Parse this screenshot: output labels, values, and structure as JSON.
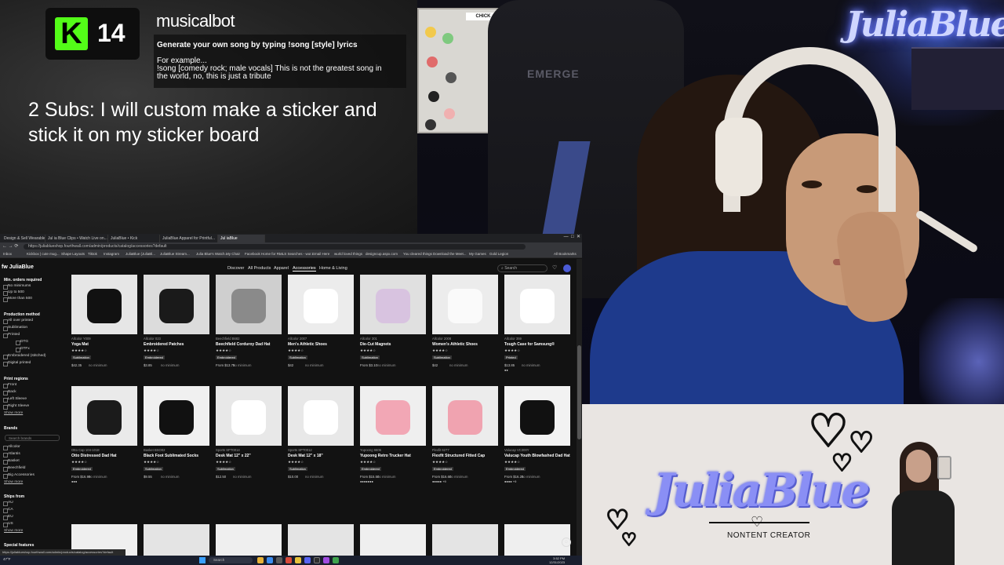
{
  "overlay": {
    "kick_logo": "K",
    "kick_count": "14",
    "bot_title": "musicalbot",
    "bot_line1": "Generate your own song by typing !song [style] lyrics",
    "bot_line2": "For example...",
    "bot_line3": "!song [comedy rock; male vocals] This is not the greatest song in",
    "bot_line4": "the world, no, this is just a tribute",
    "subs_goal": "2 Subs: I will custom make a sticker and stick it on my sticker board",
    "kick_color": "#53fc18"
  },
  "room": {
    "neon_sign": "JuliaBlue",
    "chair_logo": "EMERGE",
    "board_header": "CHICK"
  },
  "brand_panel": {
    "name": "JuliaBlue",
    "tagline": "NONTENT CREATOR",
    "accent": "#8a8ff5"
  },
  "browser": {
    "tabs": [
      "Design & Sell Wearables...",
      "Jul ia Blue Clips • Watch Live on...",
      "JuliaBlue • Kick",
      "JuliaBlue Apparel for Printful...",
      "Jul iaBlue"
    ],
    "url": "https://juliablueshop.fourthwall.com/admin/products/catalog/accessories?default",
    "bookmarks": [
      "Inbox",
      "Kickbox | cute mug...",
      "Shape Layouts",
      "Tiktok",
      "Instagram",
      "JuliaBlue (JuliaBl...",
      "JuliaBlue Stream...",
      "Julia Blue's Watch...",
      "My Chair",
      "Facebook Home for R...",
      "MLS Searches - wor...",
      "Email Here",
      "wurld loved things",
      "designcup.aspx.com",
      "You cleared things",
      "Download the Meet...",
      "My Games",
      "Gold Legion",
      "All Bookmarks"
    ],
    "site_logo": "fw  JuliaBlue",
    "nav": [
      "Discover",
      "All Products",
      "Apparel",
      "Accessories",
      "Home & Living"
    ],
    "active_nav": "Accessories",
    "search_placeholder": "Search",
    "filters": {
      "min_orders_head": "Min. orders required",
      "min_orders": [
        "No minimums",
        "Up to 500",
        "More than 500"
      ],
      "production_head": "Production method",
      "production": [
        "All over printed",
        "Sublimation",
        "Printed",
        "DTG",
        "DTFx",
        "Embroidered (stitched)",
        "Digital printed"
      ],
      "print_regions_head": "Print regions",
      "print_regions": [
        "Front",
        "Back",
        "Left Sleeve",
        "Right Sleeve"
      ],
      "show_more": "Show more",
      "brands_head": "Brands",
      "brand_search": "Search brands",
      "brands": [
        "Allcolor",
        "Atlantis",
        "Basket",
        "Beechfield",
        "Big Accessories"
      ],
      "ships_head": "Ships from",
      "ships": [
        "AU",
        "CA",
        "EU",
        "US"
      ],
      "special_head": "Special features"
    },
    "products_row1": [
      {
        "brand": "Allcolor Y009",
        "name": "Yoga Mat",
        "tag": "Sublimation",
        "price": "$42.35",
        "min": "no minimum",
        "swatches": ""
      },
      {
        "brand": "Allcolor 023",
        "name": "Embroidered Patches",
        "tag": "Embroidered",
        "price": "$3.85",
        "min": "no minimum",
        "swatches": ""
      },
      {
        "brand": "Beechfield B682",
        "name": "Beechfield Corduroy Dad Hat",
        "tag": "Embroidered",
        "price": "From $13.75",
        "min": "no minimum",
        "swatches": ""
      },
      {
        "brand": "Allcolor 2007",
        "name": "Men's Athletic Shoes",
        "tag": "Sublimation",
        "price": "$42",
        "min": "no minimum",
        "swatches": ""
      },
      {
        "brand": "Allcolor 301",
        "name": "Die-Cut Magnets",
        "tag": "Sublimation",
        "price": "From $3.10",
        "min": "no minimum",
        "swatches": ""
      },
      {
        "brand": "Allcolor 2008",
        "name": "Women's Athletic Shoes",
        "tag": "Sublimation",
        "price": "$42",
        "min": "no minimum",
        "swatches": ""
      },
      {
        "brand": "Allcolor 359",
        "name": "Tough Case for Samsung®",
        "tag": "Printed",
        "price": "$13.85",
        "min": "no minimum",
        "swatches": "●●"
      }
    ],
    "products_row2": [
      {
        "brand": "Otto Cap 104-1018",
        "name": "Otto Distressed Dad Hat",
        "tag": "Embroidered",
        "price": "From $16.99",
        "min": "no minimum",
        "swatches": "●●●"
      },
      {
        "brand": "Basket BSO02",
        "name": "Black Foot Sublimated Socks",
        "tag": "Sublimation",
        "price": "$9.55",
        "min": "no minimum",
        "swatches": ""
      },
      {
        "brand": "Sports SPT0014",
        "name": "Desk Mat 12\" x 22\"",
        "tag": "Sublimation",
        "price": "$12.50",
        "min": "no minimum",
        "swatches": ""
      },
      {
        "brand": "Sports SPT0012",
        "name": "Desk Mat 12\" x 18\"",
        "tag": "Sublimation",
        "price": "$10.00",
        "min": "no minimum",
        "swatches": ""
      },
      {
        "brand": "Yupoong 6606",
        "name": "Yupoong Retro Trucker Hat",
        "tag": "Embroidered",
        "price": "From $15.50",
        "min": "no minimum",
        "swatches": "●●●●●●●"
      },
      {
        "brand": "Flexfit 6277",
        "name": "Flexfit Structured Fitted Cap",
        "tag": "Embroidered",
        "price": "From $16.60",
        "min": "no minimum",
        "swatches": "●●●●● +9"
      },
      {
        "brand": "Valucap VC300Y",
        "name": "Valucap Youth Blowfashed Dad Hat",
        "tag": "Embroidered",
        "price": "From $16.25",
        "min": "no minimum",
        "swatches": "●●●● +9"
      }
    ],
    "status_url": "https://juliablueshop.fourthwall.com/admin/products/catalog/accessories?default",
    "chat_icon": "☺"
  },
  "taskbar": {
    "weather": "47°F",
    "search": "Search",
    "time": "3:52 PM",
    "date": "12/31/2023"
  }
}
